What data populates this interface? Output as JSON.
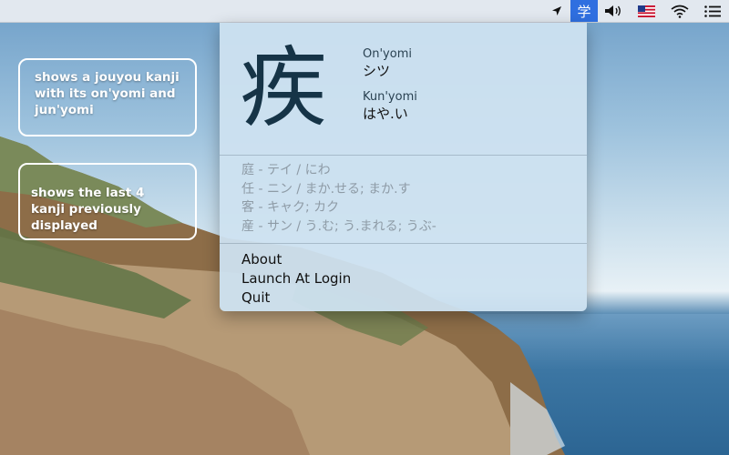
{
  "menubar": {
    "app_label": "学",
    "icons": [
      "location-arrow-icon",
      "app-kanji-icon",
      "volume-icon",
      "us-flag-icon",
      "wifi-icon",
      "list-menu-icon"
    ]
  },
  "callouts": [
    "shows a jouyou kanji with its on'yomi and jun'yomi",
    "shows the last 4 kanji previously displayed"
  ],
  "current": {
    "kanji": "疾",
    "onyomi_label": "On'yomi",
    "onyomi": "シツ",
    "kunyomi_label": "Kun'yomi",
    "kunyomi": "はや.い"
  },
  "history": [
    "庭 - テイ / にわ",
    "任 - ニン / まか.せる; まか.す",
    "客 - キャク; カク",
    "産 - サン / う.む; う.まれる; うぶ-"
  ],
  "menu": {
    "about": "About",
    "launch_at_login": "Launch At Login",
    "quit": "Quit"
  }
}
